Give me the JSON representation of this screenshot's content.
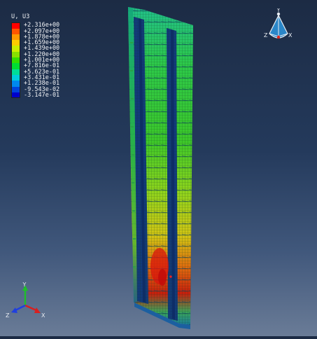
{
  "legend": {
    "title": "U, U3",
    "entries": [
      {
        "label": "+2.316e+00",
        "color": "#ff0000"
      },
      {
        "label": "+2.097e+00",
        "color": "#ff5500"
      },
      {
        "label": "+1.878e+00",
        "color": "#ff9900"
      },
      {
        "label": "+1.659e+00",
        "color": "#ffcc00"
      },
      {
        "label": "+1.439e+00",
        "color": "#ccee00"
      },
      {
        "label": "+1.220e+00",
        "color": "#88e000"
      },
      {
        "label": "+1.001e+00",
        "color": "#33dd00"
      },
      {
        "label": "+7.816e-01",
        "color": "#00dd33"
      },
      {
        "label": "+5.623e-01",
        "color": "#00dd99"
      },
      {
        "label": "+3.431e-01",
        "color": "#00ccdd"
      },
      {
        "label": "+1.238e-01",
        "color": "#0088ee"
      },
      {
        "label": "-9.543e-02",
        "color": "#0044dd"
      },
      {
        "label": "-3.147e-01",
        "color": "#0000cc"
      }
    ]
  },
  "triad_top": {
    "y_label": "Y",
    "z_label": "Z",
    "x_label": "X"
  },
  "triad_bottom": {
    "y_label": "Y",
    "z_label": "Z",
    "x_label": "X"
  }
}
